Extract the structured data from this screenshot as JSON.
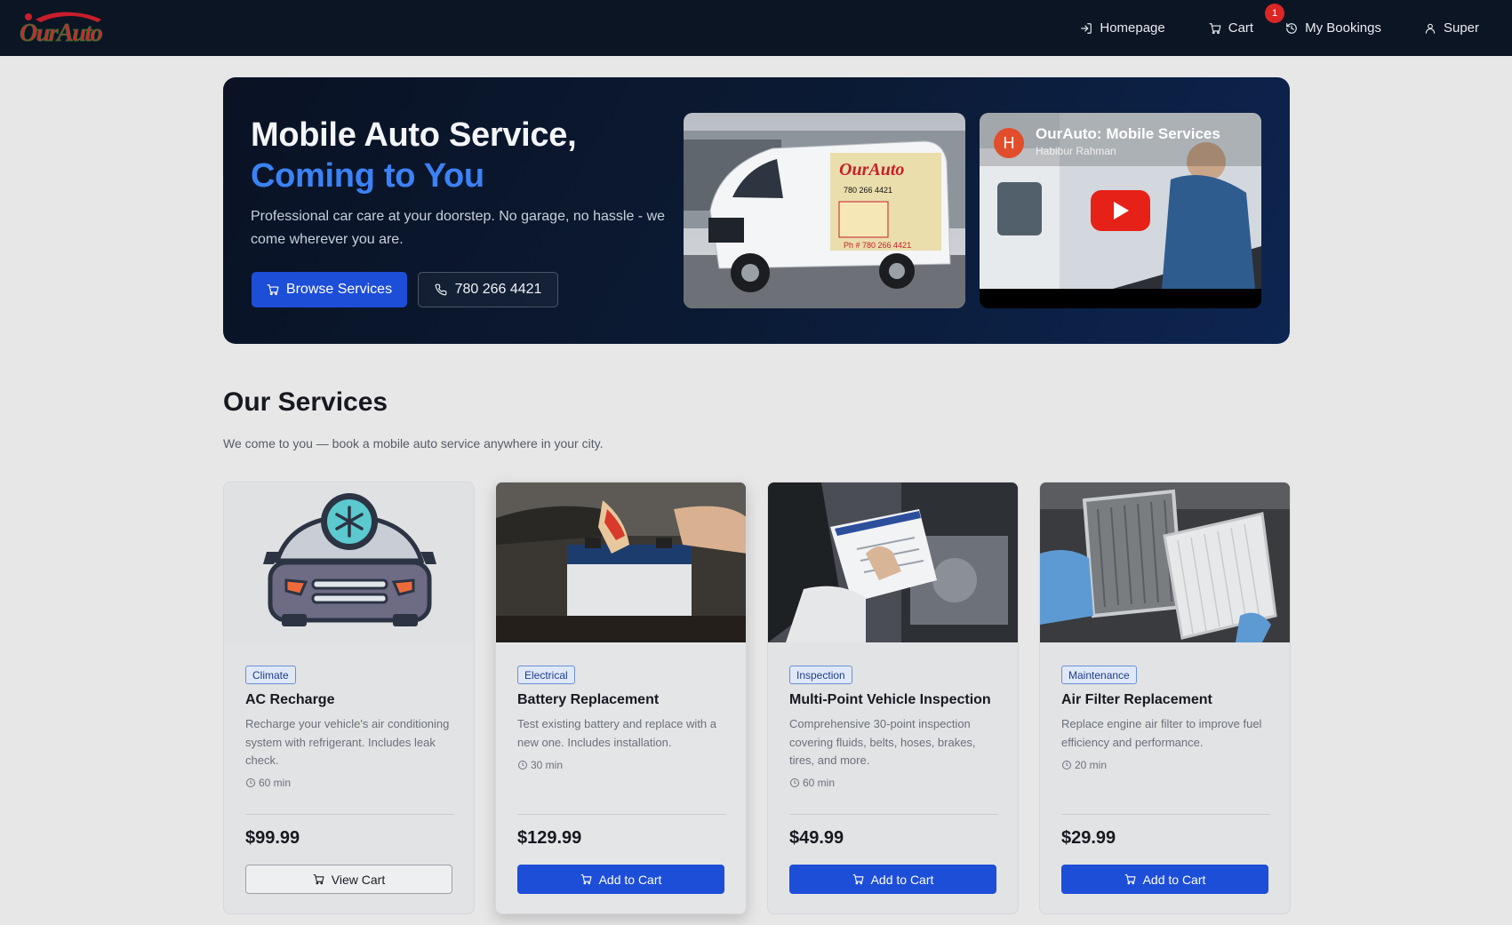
{
  "nav": {
    "logo_text": "OurAuto",
    "home_label": "Homepage",
    "cart_label": "Cart",
    "cart_count": "1",
    "bookings_label": "My Bookings",
    "user_label": "Super"
  },
  "hero": {
    "title": "Mobile Auto Service,",
    "title_accent": "Coming to You",
    "subtitle": "Professional car care at your doorstep. No garage, no hassle - we come wherever you are.",
    "browse_label": "Browse Services",
    "phone_label": "780 266 4421",
    "van_logo_text": "OurAuto",
    "van_phone": "780 266 4421",
    "van_phone_ph": "Ph # 780 266 4421",
    "video": {
      "channel_initial": "H",
      "title": "OurAuto: Mobile Services",
      "author": "Habibur Rahman"
    }
  },
  "services": {
    "title": "Our Services",
    "subtitle": "We come to you — book a mobile auto service anywhere in your city.",
    "cards": [
      {
        "category": "Climate",
        "name": "AC Recharge",
        "description": "Recharge your vehicle's air conditioning system with refrigerant. Includes leak check.",
        "duration": "60 min",
        "price": "$99.99",
        "button": "View Cart",
        "icon": "ac-car-icon"
      },
      {
        "category": "Electrical",
        "name": "Battery Replacement",
        "description": "Test existing battery and replace with a new one. Includes installation.",
        "duration": "30 min",
        "price": "$129.99",
        "button": "Add to Cart",
        "icon": "battery-photo"
      },
      {
        "category": "Inspection",
        "name": "Multi-Point Vehicle Inspection",
        "description": "Comprehensive 30-point inspection covering fluids, belts, hoses, brakes, tires, and more.",
        "duration": "60 min",
        "price": "$49.99",
        "button": "Add to Cart",
        "icon": "inspection-photo"
      },
      {
        "category": "Maintenance",
        "name": "Air Filter Replacement",
        "description": "Replace engine air filter to improve fuel efficiency and performance.",
        "duration": "20 min",
        "price": "$29.99",
        "button": "Add to Cart",
        "icon": "air-filter-photo"
      }
    ]
  },
  "colors": {
    "nav_bg": "#0c1524",
    "primary": "#1d4ed8",
    "accent": "#3b82f6",
    "badge_red": "#dc2626"
  }
}
